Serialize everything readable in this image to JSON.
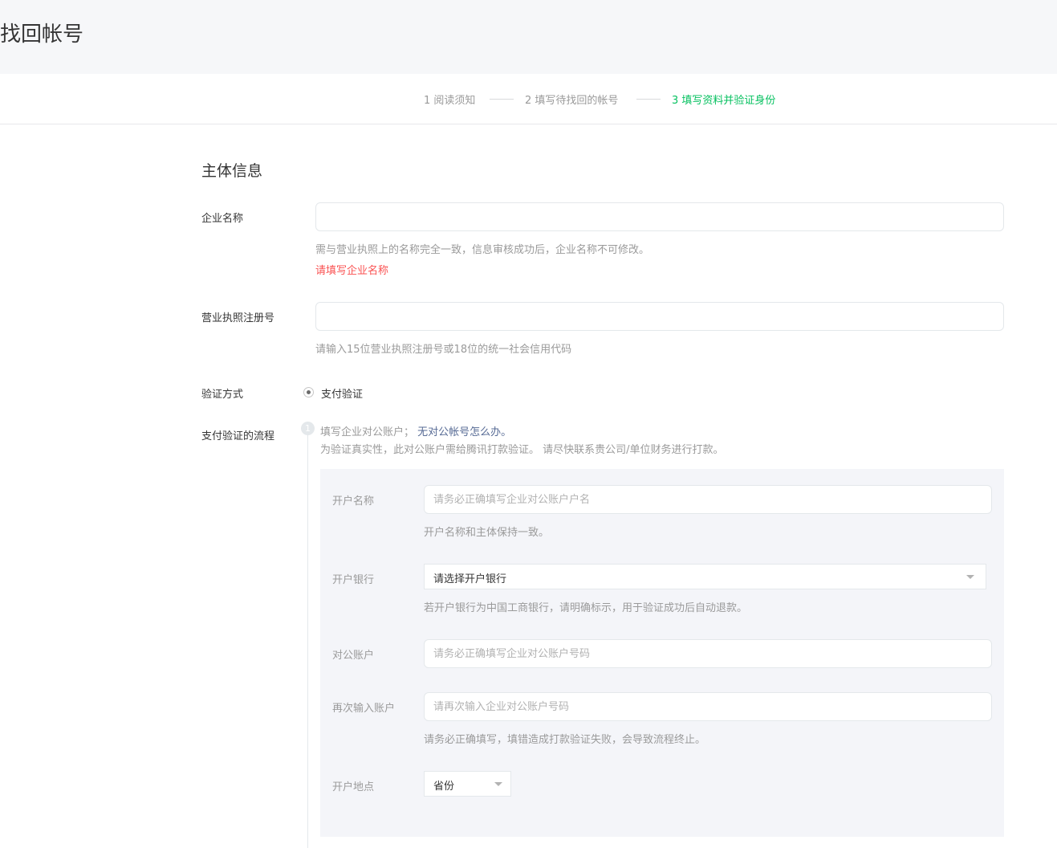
{
  "page": {
    "title": "找回帐号"
  },
  "steps": [
    {
      "label": "1 阅读须知"
    },
    {
      "label": "2 填写待找回的帐号"
    },
    {
      "label": "3 填写资料并验证身份"
    }
  ],
  "section": {
    "title": "主体信息"
  },
  "company_name": {
    "label": "企业名称",
    "value": "",
    "tip": "需与营业执照上的名称完全一致，信息审核成功后，企业名称不可修改。",
    "error": "请填写企业名称"
  },
  "license": {
    "label": "营业执照注册号",
    "value": "",
    "tip": "请输入15位营业执照注册号或18位的统一社会信用代码"
  },
  "verify_method": {
    "label": "验证方式",
    "option": "支付验证",
    "selected": true
  },
  "pay_flow": {
    "label": "支付验证的流程",
    "step_number": "1",
    "step_text": "填写企业对公账户；",
    "step_link": "无对公帐号怎么办。",
    "step_desc": "为验证真实性，此对公账户需给腾讯打款验证。 请尽快联系贵公司/单位财务进行打款。"
  },
  "panel": {
    "account_name": {
      "label": "开户名称",
      "placeholder": "请务必正确填写企业对公账户户名",
      "tip": "开户名称和主体保持一致。"
    },
    "bank": {
      "label": "开户银行",
      "selected": "请选择开户银行",
      "tip": "若开户银行为中国工商银行，请明确标示，用于验证成功后自动退款。"
    },
    "account": {
      "label": "对公账户",
      "placeholder": "请务必正确填写企业对公账户号码"
    },
    "account_confirm": {
      "label": "再次输入账户",
      "placeholder": "请再次输入企业对公账户号码",
      "tip": "请务必正确填写，填错造成打款验证失败，会导致流程终止。"
    },
    "location": {
      "label": "开户地点",
      "selected": "省份"
    }
  },
  "colors": {
    "accent": "#07c160",
    "error": "#fa5151",
    "link": "#576b95",
    "muted": "#9a9a9a",
    "panel_bg": "#f4f5f9",
    "header_bg": "#f6f7f9"
  }
}
